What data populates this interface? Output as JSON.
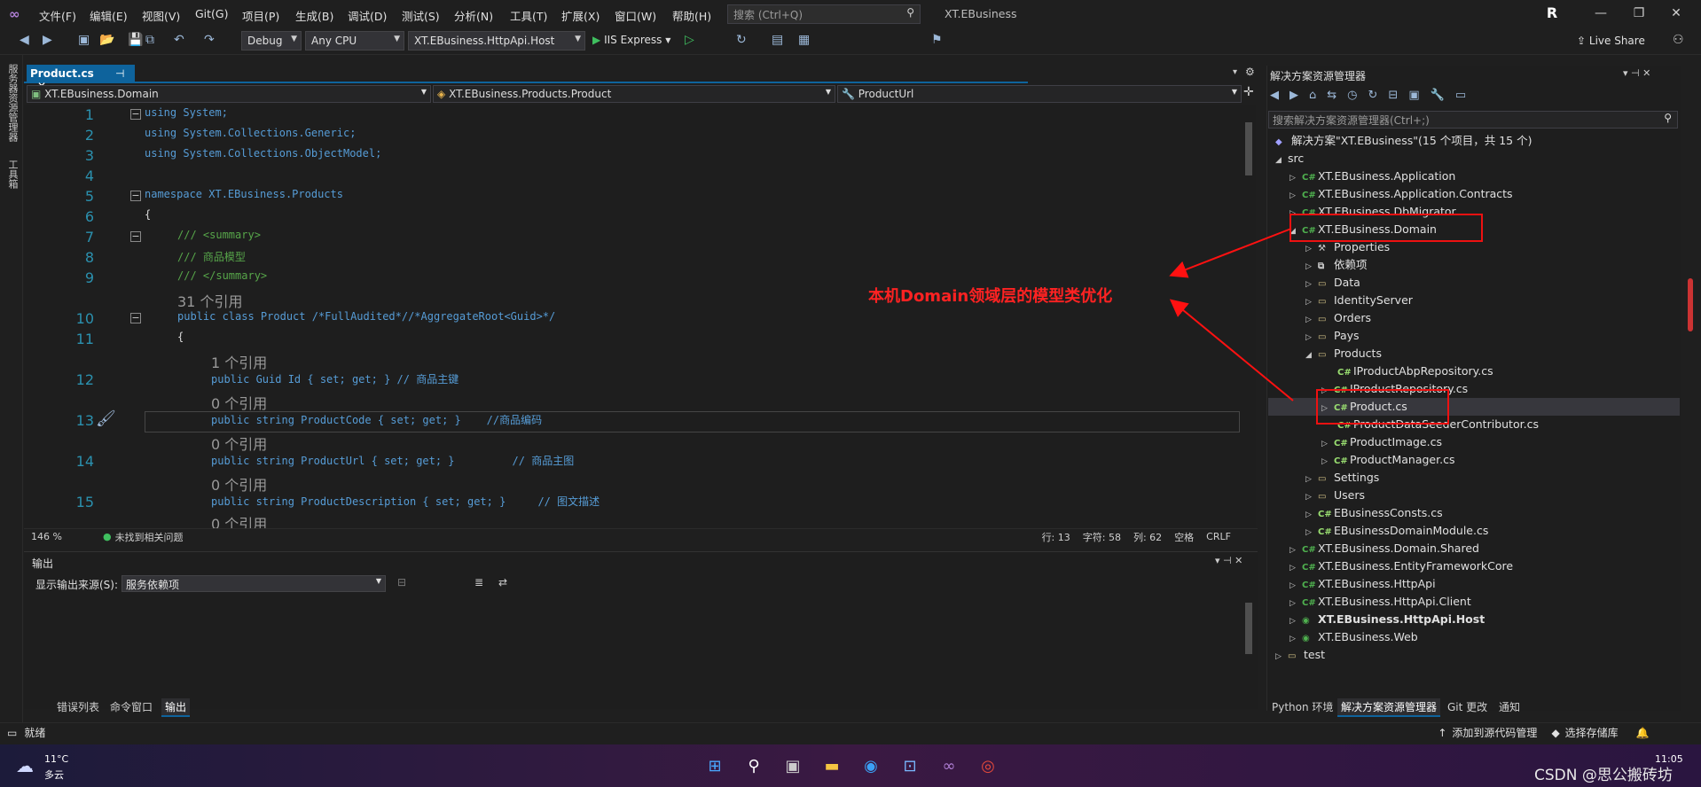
{
  "menubar": {
    "items": [
      "文件(F)",
      "编辑(E)",
      "视图(V)",
      "Git(G)",
      "项目(P)",
      "生成(B)",
      "调试(D)",
      "测试(S)",
      "分析(N)",
      "工具(T)",
      "扩展(X)",
      "窗口(W)",
      "帮助(H)"
    ],
    "search_placeholder": "搜索 (Ctrl+Q)",
    "app_title": "XT.EBusiness",
    "avatar": "R"
  },
  "toolbar": {
    "config": "Debug",
    "platform": "Any CPU",
    "startup_project": "XT.EBusiness.HttpApi.Host",
    "run_target": "IIS Express",
    "live_share": "Live Share"
  },
  "left_rail": {
    "items": [
      "服务器资源管理器",
      "工具箱"
    ]
  },
  "editor": {
    "tab": "Product.cs",
    "nav_project": "XT.EBusiness.Domain",
    "nav_class": "XT.EBusiness.Products.Product",
    "nav_member": "ProductUrl",
    "zoom": "146 %",
    "issues": "未找到相关问题",
    "line": "行: 13",
    "col": "字符: 58",
    "pos": "列: 62",
    "ws": "空格",
    "eol": "CRLF"
  },
  "code": {
    "line_numbers": [
      "1",
      "2",
      "3",
      "4",
      "5",
      "6",
      "7",
      "8",
      "9",
      "10",
      "11",
      "12",
      "13",
      "14",
      "15"
    ],
    "using1": "using System;",
    "using2": "using System.Collections.Generic;",
    "using3": "using System.Collections.ObjectModel;",
    "ns": "namespace XT.EBusiness.Products",
    "brace_open": "{",
    "sum1": "/// <summary>",
    "sum2": "/// 商品模型",
    "sum3": "/// </summary>",
    "ref31": "31 个引用",
    "class_decl": "public class Product /*FullAudited*//*AggregateRoot<Guid>*/",
    "brace_open2": "{",
    "ref1": "1 个引用",
    "prop_id": "public Guid Id { set; get; } // 商品主键",
    "ref0a": "0 个引用",
    "prop_code": "public string ProductCode { set; get; }    //商品编码",
    "ref0b": "0 个引用",
    "prop_url": "public string ProductUrl { set; get; }         // 商品主图",
    "ref0c": "0 个引用",
    "prop_desc": "public string ProductDescription { set; get; }     // 图文描述",
    "ref0d": "0 个引用"
  },
  "output": {
    "title": "输出",
    "source_label": "显示输出来源(S):",
    "source_value": "服务依赖项",
    "tabs": [
      "错误列表",
      "命令窗口",
      "输出"
    ]
  },
  "solution": {
    "title": "解决方案资源管理器",
    "search_placeholder": "搜索解决方案资源管理器(Ctrl+;)",
    "root": "解决方案\"XT.EBusiness\"(15 个项目，共 15 个)",
    "items": [
      {
        "label": "src",
        "icon": "folder"
      },
      {
        "label": "XT.EBusiness.Application",
        "icon": "project"
      },
      {
        "label": "XT.EBusiness.Application.Contracts",
        "icon": "project"
      },
      {
        "label": "XT.EBusiness.DbMigrator",
        "icon": "project"
      },
      {
        "label": "XT.EBusiness.Domain",
        "icon": "project"
      },
      {
        "label": "Properties",
        "icon": "wrench"
      },
      {
        "label": "依赖项",
        "icon": "deps"
      },
      {
        "label": "Data",
        "icon": "folder"
      },
      {
        "label": "IdentityServer",
        "icon": "folder"
      },
      {
        "label": "Orders",
        "icon": "folder"
      },
      {
        "label": "Pays",
        "icon": "folder"
      },
      {
        "label": "Products",
        "icon": "folder"
      },
      {
        "label": "IProductAbpRepository.cs",
        "icon": "cs"
      },
      {
        "label": "IProductRepository.cs",
        "icon": "cs"
      },
      {
        "label": "Product.cs",
        "icon": "cs"
      },
      {
        "label": "ProductDataSeederContributor.cs",
        "icon": "cs"
      },
      {
        "label": "ProductImage.cs",
        "icon": "cs"
      },
      {
        "label": "ProductManager.cs",
        "icon": "cs"
      },
      {
        "label": "Settings",
        "icon": "folder"
      },
      {
        "label": "Users",
        "icon": "folder"
      },
      {
        "label": "EBusinessConsts.cs",
        "icon": "cs"
      },
      {
        "label": "EBusinessDomainModule.cs",
        "icon": "cs"
      },
      {
        "label": "XT.EBusiness.Domain.Shared",
        "icon": "project"
      },
      {
        "label": "XT.EBusiness.EntityFrameworkCore",
        "icon": "project"
      },
      {
        "label": "XT.EBusiness.HttpApi",
        "icon": "project"
      },
      {
        "label": "XT.EBusiness.HttpApi.Client",
        "icon": "project"
      },
      {
        "label": "XT.EBusiness.HttpApi.Host",
        "icon": "project"
      },
      {
        "label": "XT.EBusiness.Web",
        "icon": "project"
      },
      {
        "label": "test",
        "icon": "folder"
      }
    ],
    "tabs": [
      "Python 环境",
      "解决方案资源管理器",
      "Git 更改",
      "通知"
    ]
  },
  "annotation": {
    "text": "本机Domain领域层的模型类优化"
  },
  "statusbar": {
    "ready": "就绪",
    "add_source": "添加到源代码管理",
    "select_repo": "选择存储库"
  },
  "taskbar": {
    "weather_temp": "11°C",
    "weather_desc": "多云",
    "time": "11:05",
    "watermark": "CSDN @思公搬砖坊"
  },
  "colors": {
    "accent": "#0e639c",
    "annotation_red": "#ff2222",
    "keyword": "#569cd6",
    "type": "#4ec9b0",
    "comment": "#57a64a"
  }
}
